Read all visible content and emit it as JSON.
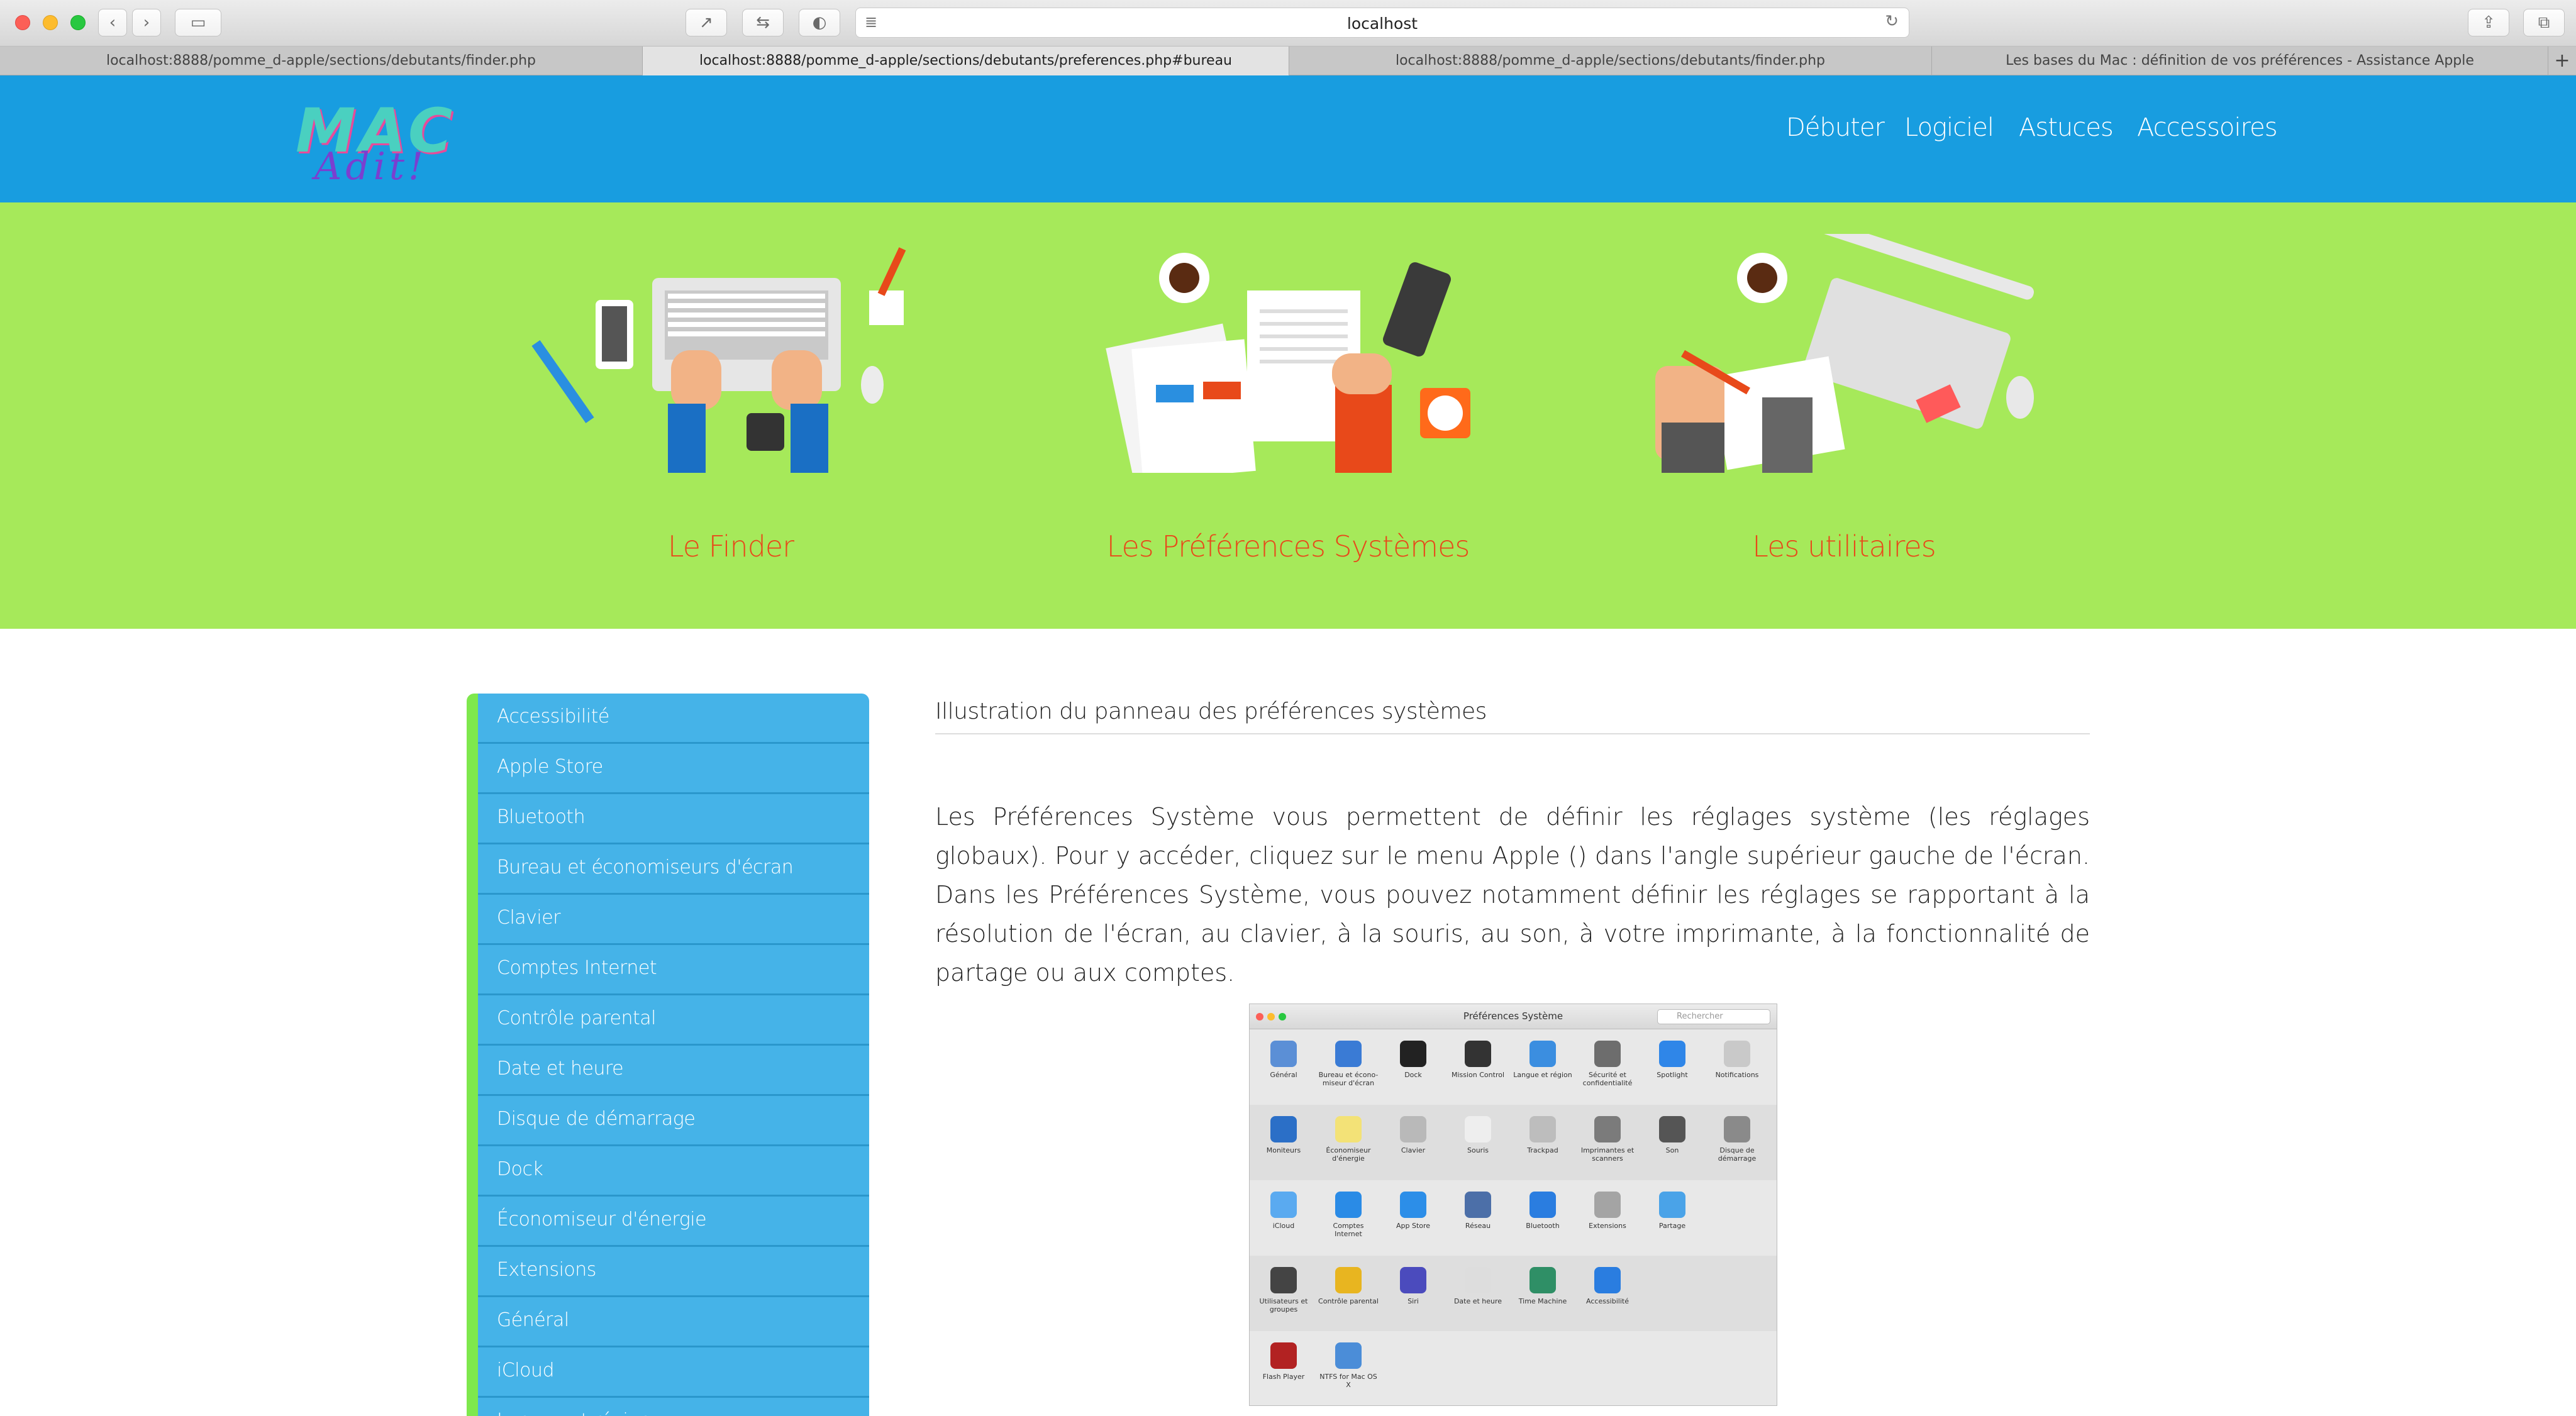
{
  "browser": {
    "url": "localhost",
    "tabs": [
      {
        "title": "localhost:8888/pomme_d-apple/sections/debutants/finder.php",
        "active": false
      },
      {
        "title": "localhost:8888/pomme_d-apple/sections/debutants/preferences.php#bureau",
        "active": true
      },
      {
        "title": "localhost:8888/pomme_d-apple/sections/debutants/finder.php",
        "active": false
      },
      {
        "title": "Les bases du Mac : définition de vos préférences - Assistance Apple",
        "active": false
      }
    ],
    "new_tab_label": "+"
  },
  "site": {
    "logo_line1": "MAC",
    "logo_line2": "Adit!",
    "nav": [
      "Débuter",
      "Logiciel",
      "Astuces",
      "Accessoires"
    ],
    "colors": {
      "header": "#189de0",
      "hero": "#a6e95a",
      "accent": "#e8491a",
      "sidebar": "#45b3e8",
      "sidebar_border": "#7ee84d"
    }
  },
  "hero": {
    "categories": [
      {
        "label": "Le Finder"
      },
      {
        "label": "Les Préférences Systèmes"
      },
      {
        "label": "Les utilitaires"
      }
    ]
  },
  "sidebar": {
    "items": [
      "Accessibilité",
      "Apple Store",
      "Bluetooth",
      "Bureau et économiseurs d'écran",
      "Clavier",
      "Comptes Internet",
      "Contrôle parental",
      "Date et heure",
      "Disque de démarrage",
      "Dock",
      "Économiseur d'énergie",
      "Extensions",
      "Général",
      "iCloud",
      "Langue et région"
    ]
  },
  "content": {
    "title": "Illustration du panneau des préférences systèmes",
    "paragraph": "Les Préférences Système vous permettent de définir les réglages système (les réglages globaux). Pour y accéder, cliquez sur le menu Apple () dans l'angle supérieur gauche de l'écran. Dans les Préférences Système, vous pouvez notamment définir les réglages se rapportant à la résolution de l'écran, au clavier, à la souris, au son, à votre imprimante, à la fonctionnalité de partage ou aux comptes."
  },
  "prefs_window": {
    "title": "Préférences Système",
    "search_placeholder": "Rechercher",
    "rows": [
      [
        {
          "label": "Général",
          "color": "#5b8fd6"
        },
        {
          "label": "Bureau et écono-miseur d'écran",
          "color": "#3a7bd5"
        },
        {
          "label": "Dock",
          "color": "#222222"
        },
        {
          "label": "Mission Control",
          "color": "#333333"
        },
        {
          "label": "Langue et région",
          "color": "#3b8ee0"
        },
        {
          "label": "Sécurité et confidentialité",
          "color": "#6d6d6d"
        },
        {
          "label": "Spotlight",
          "color": "#2f86e8"
        },
        {
          "label": "Notifications",
          "color": "#c9c9c9"
        }
      ],
      [
        {
          "label": "Moniteurs",
          "color": "#2b6fc7"
        },
        {
          "label": "Économiseur d'énergie",
          "color": "#f3e277"
        },
        {
          "label": "Clavier",
          "color": "#b9b9b9"
        },
        {
          "label": "Souris",
          "color": "#eeeeee"
        },
        {
          "label": "Trackpad",
          "color": "#bdbdbd"
        },
        {
          "label": "Imprimantes et scanners",
          "color": "#7b7b7b"
        },
        {
          "label": "Son",
          "color": "#555555"
        },
        {
          "label": "Disque de démarrage",
          "color": "#8a8a8a"
        }
      ],
      [
        {
          "label": "iCloud",
          "color": "#5aaaf0"
        },
        {
          "label": "Comptes Internet",
          "color": "#2a8be6"
        },
        {
          "label": "App Store",
          "color": "#2c8ee8"
        },
        {
          "label": "Réseau",
          "color": "#4c6fa8"
        },
        {
          "label": "Bluetooth",
          "color": "#2a7de0"
        },
        {
          "label": "Extensions",
          "color": "#a4a4a4"
        },
        {
          "label": "Partage",
          "color": "#4aa3e8"
        }
      ],
      [
        {
          "label": "Utilisateurs et groupes",
          "color": "#444444"
        },
        {
          "label": "Contrôle parental",
          "color": "#e8b520"
        },
        {
          "label": "Siri",
          "color": "#4b4bbd"
        },
        {
          "label": "Date et heure",
          "color": "#dddddd"
        },
        {
          "label": "Time Machine",
          "color": "#2f8f66"
        },
        {
          "label": "Accessibilité",
          "color": "#2a7de0"
        }
      ],
      [
        {
          "label": "Flash Player",
          "color": "#b22222"
        },
        {
          "label": "NTFS for Mac OS X",
          "color": "#4b8dd8"
        }
      ]
    ]
  }
}
